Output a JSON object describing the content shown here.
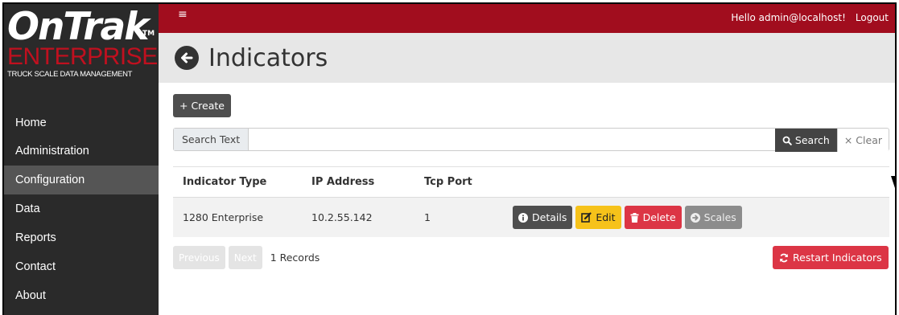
{
  "brand": {
    "top": "OnTrak",
    "tm": "TM",
    "middle": "ENTERPRISE",
    "sub": "TRUCK SCALE DATA MANAGEMENT"
  },
  "sidebar": {
    "items": [
      {
        "label": "Home"
      },
      {
        "label": "Administration"
      },
      {
        "label": "Configuration"
      },
      {
        "label": "Data"
      },
      {
        "label": "Reports"
      },
      {
        "label": "Contact"
      },
      {
        "label": "About"
      }
    ]
  },
  "topbar": {
    "menu_icon": "≡",
    "greeting": "Hello admin@localhost!",
    "logout": "Logout"
  },
  "page": {
    "title": "Indicators"
  },
  "toolbar": {
    "create": "+ Create"
  },
  "search": {
    "label": "Search Text",
    "value": "",
    "search_button": "Search",
    "clear_button": "× Clear"
  },
  "table": {
    "headers": [
      "Indicator Type",
      "IP Address",
      "Tcp Port"
    ],
    "rows": [
      {
        "type": "1280 Enterprise",
        "ip": "10.2.55.142",
        "port": "1"
      }
    ],
    "actions": {
      "details": "Details",
      "edit": "Edit",
      "delete": "Delete",
      "scales": "Scales"
    }
  },
  "pager": {
    "previous": "Previous",
    "next": "Next",
    "records": "1 Records"
  },
  "restart_button": "Restart Indicators",
  "colors": {
    "topbar": "#a10d1e",
    "sidebar": "#2a2a2a",
    "active_nav": "#555555",
    "danger": "#dc3545",
    "warning": "#f6c21a"
  }
}
